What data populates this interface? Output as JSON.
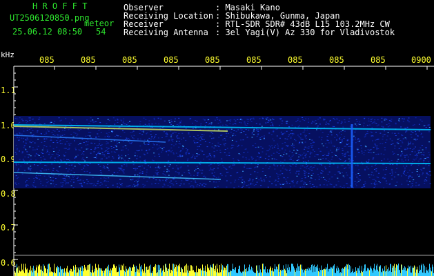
{
  "app": {
    "title": "H R O F F T"
  },
  "file": {
    "name": "UT2506120850.png",
    "tag": "meteor",
    "datetime": "25.06.12 08:50",
    "count": "54"
  },
  "info": {
    "labels": [
      "Observer",
      "Receiving Location",
      "Receiver",
      "Receiving Antenna"
    ],
    "values": [
      ": Masaki Kano",
      ": Shibukawa, Gunma, Japan",
      ": RTL-SDR SDR# 43dB L15 103.2MHz CW",
      ": 3el Yagi(V) Az 330 for Vladivostok"
    ]
  },
  "axis": {
    "y_unit": "kHz",
    "y_ticks": [
      "1.1",
      "1.0",
      "0.9",
      "0.8",
      "0.7",
      "0.6"
    ],
    "x_ticks": [
      "085",
      "085",
      "085",
      "085",
      "085",
      "085",
      "085",
      "085",
      "085",
      "0900"
    ]
  },
  "colors": {
    "text": "#ffffff",
    "title": "#2ee82e",
    "trace": "#ffff30",
    "signal": "#00c8ff",
    "noise": "#0a23c8"
  }
}
